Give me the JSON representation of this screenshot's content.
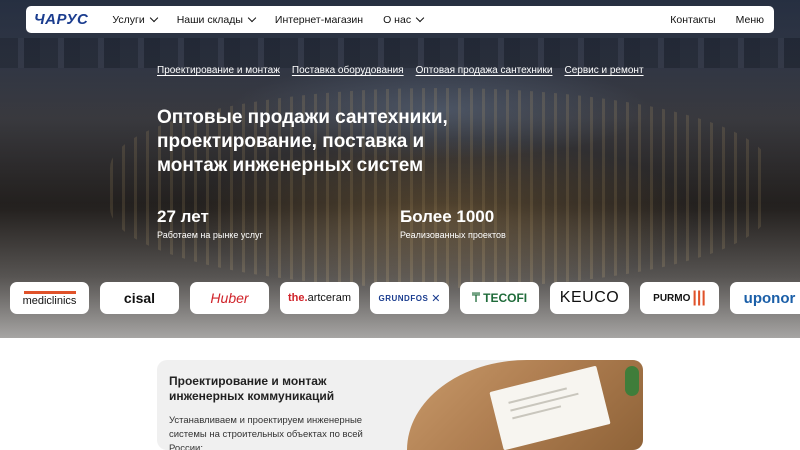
{
  "header": {
    "logo": "ЧАРУС",
    "nav": [
      {
        "label": "Услуги",
        "dropdown": true
      },
      {
        "label": "Наши склады",
        "dropdown": true
      },
      {
        "label": "Интернет-магазин",
        "dropdown": false
      },
      {
        "label": "О нас",
        "dropdown": true
      }
    ],
    "contacts": "Контакты",
    "menu": "Меню"
  },
  "subnav": [
    "Проектирование и монтаж",
    "Поставка оборудования",
    "Оптовая продажа сантехники",
    "Сервис и ремонт"
  ],
  "hero": {
    "headline": "Оптовые продажи сантехники, проектирование, поставка и монтаж инженерных систем",
    "stats": [
      {
        "value": "27 лет",
        "label": "Работаем на рынке услуг"
      },
      {
        "value": "Более 1000",
        "label": "Реализованных проектов"
      }
    ]
  },
  "brands": [
    "mediclinics",
    "cisal",
    "Huber",
    "the.artceram",
    "GRUNDFOS",
    "TECOFI",
    "KEUCO",
    "PURMO",
    "uponor"
  ],
  "card": {
    "title": "Проектирование и монтаж инженерных коммуникаций",
    "text": "Устанавливаем и проектируем инженерные системы на строительных объектах по всей России:"
  },
  "colors": {
    "brand_blue": "#1b3d8f",
    "card_bg": "#f0f0f0"
  }
}
